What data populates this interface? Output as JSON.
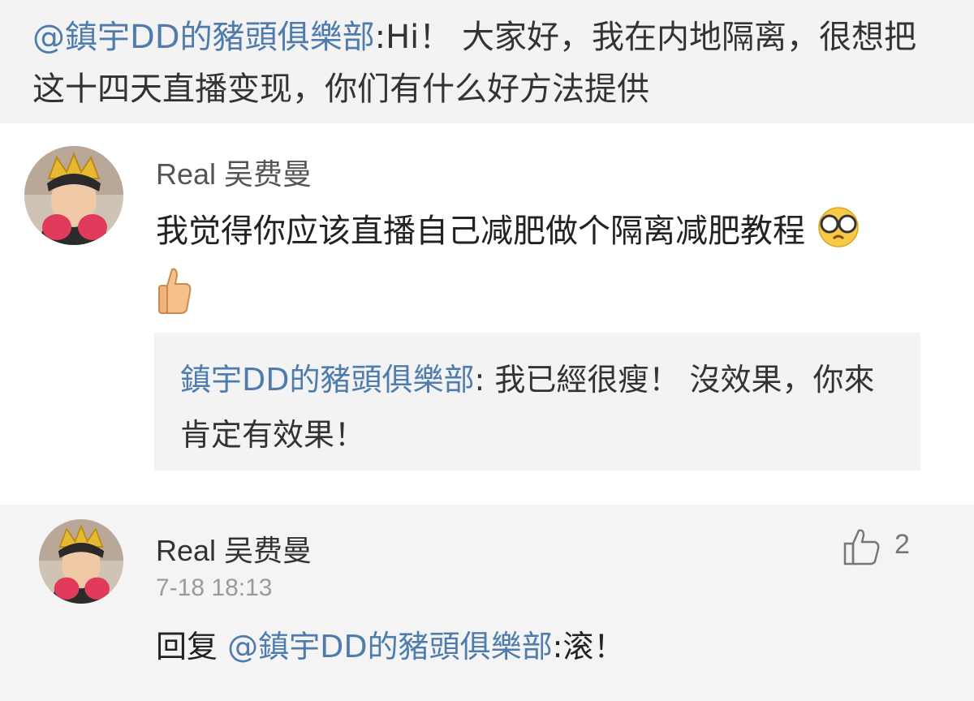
{
  "top_quote": {
    "mention": "@鎮宇DD的豬頭俱樂部",
    "text": ":Hi！ 大家好，我在内地隔离，很想把这十四天直播变现，你们有什么好方法提供"
  },
  "comment1": {
    "username": "Real 吴费曼",
    "body": "我觉得你应该直播自己减肥做个隔离减肥教程",
    "emojis": [
      "glasses-emoji",
      "thumbs-up-emoji"
    ]
  },
  "reply_quote": {
    "name": "鎮宇DD的豬頭俱樂部",
    "text": ": 我已經很瘦！ 沒效果，你來肯定有效果！"
  },
  "comment2": {
    "username": "Real 吴费曼",
    "timestamp": "7-18 18:13",
    "likes": "2",
    "reply_prefix": "回复 ",
    "mention": "@鎮宇DD的豬頭俱樂部",
    "reply_text": ":滚！"
  },
  "colors": {
    "mention": "#4f7cad",
    "background_gray": "#f3f3f3"
  }
}
